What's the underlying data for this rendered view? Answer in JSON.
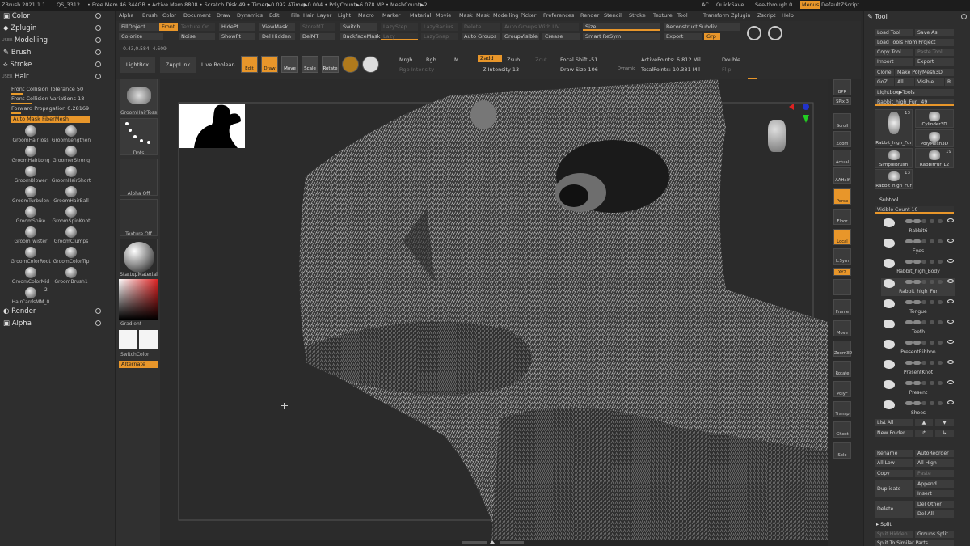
{
  "titlebar": {
    "app": "ZBrush 2021.1.1",
    "project": "QS_3312",
    "stats": "• Free Mem 46.344GB • Active Mem 8808 • Scratch Disk 49 • Timer▶0.092 ATime▶0.004 • PolyCount▶6.078 MP • MeshCount▶2",
    "ac": "AC",
    "quicksave": "QuickSave",
    "seethrough": "See-through  0",
    "menus": "Menus",
    "defaultzscript": "DefaultZScript"
  },
  "menubar": [
    "Alpha",
    "Brush",
    "Color",
    "Document",
    "Draw",
    "Dynamics",
    "Edit",
    "File",
    "Hair",
    "Layer",
    "Light",
    "Macro",
    "Marker",
    "Material",
    "Movie",
    "Mask",
    "Mask",
    "Modelling",
    "Picker",
    "Preferences",
    "Render",
    "Stencil",
    "Stroke",
    "Texture",
    "Tool",
    "Transform",
    "Zplugin",
    "Zscript",
    "Help"
  ],
  "left": {
    "sections": {
      "color": "Color",
      "zplugin": "Zplugin",
      "modelling": "Modelling",
      "brush": "Brush",
      "stroke": "Stroke",
      "hair": "Hair",
      "render": "Render",
      "alpha": "Alpha"
    },
    "user_tags": {
      "a": "USER",
      "b": "USER"
    },
    "sliders": [
      {
        "label": "Front Collision Tolerance",
        "value": "50",
        "fill": 0.5
      },
      {
        "label": "Front Collision Variations",
        "value": "18",
        "fill": 0.3
      },
      {
        "label": "Forward Propagation",
        "value": "0.28169",
        "fill": 0.28
      }
    ],
    "automask": "Auto Mask FiberMesh",
    "brushes": [
      "GroomHairToss",
      "GroomLengthen",
      "GroomHairLong",
      "GroomerStrong",
      "GroomBlower",
      "GroomHairShort",
      "GroomTurbulen",
      "GroomHairBall",
      "GroomSpike",
      "GroomSpinKnot",
      "GroomTwister",
      "GroomClumps",
      "GroomColorRoot",
      "GroomColorTip",
      "GroomColorMid",
      "GroomBrush1",
      "HairCardsMM_0",
      ""
    ],
    "hair_count": "2"
  },
  "midcol": {
    "thumbs": {
      "brush": "GroomHairToss",
      "stroke": "Dots",
      "alpha": "Alpha Off",
      "texture": "Texture Off",
      "material": "StartupMaterial"
    },
    "gradient": "Gradient",
    "switchcolor": "SwitchColor",
    "alternate": "Alternate"
  },
  "toolbar": {
    "fillobject": "FillObject",
    "front": "Front",
    "texture_on": "Texture On",
    "hidept": "HidePt",
    "viewmask": "ViewMask",
    "storemt": "StoreMT",
    "switch": "Switch",
    "lazystep": "LazyStep",
    "lazyradius": "LazyRadius",
    "delete": "Delete",
    "autogroups_uv": "Auto Groups With UV",
    "colorize": "Colorize",
    "noise": "Noise",
    "showpt": "ShowPt",
    "delhidden": "Del Hidden",
    "delmt": "DelMT",
    "backfacemask": "BackfaceMask",
    "lazymouse": "Lazy",
    "lazysnap": "LazySnap",
    "autogroups": "Auto Groups",
    "groupvisible": "GroupVisible",
    "crease": "Crease",
    "size": "Size",
    "smartresym": "Smart ReSym",
    "reconstruct": "Reconstruct Subdiv",
    "export": "Export",
    "grp": "Grp",
    "coords": "-0.43,0.584,-4.609",
    "lightbox": "LightBox",
    "zapplink": "ZAppLink",
    "live_boolean": "Live Boolean",
    "edit": "Edit",
    "draw": "Draw",
    "move": "Move",
    "scale": "Scale",
    "rotate": "Rotate",
    "mrgb": "Mrgb",
    "rgb": "Rgb",
    "m": "M",
    "rgb_intensity": "Rgb Intensity",
    "zadd": "Zadd",
    "zsub": "Zsub",
    "zcut": "Zcut",
    "z_intensity": "Z Intensity 13",
    "focal_shift": "Focal Shift -51",
    "draw_size": "Draw Size 106",
    "dynamic": "Dynamic",
    "active_points": "ActivePoints: 6.812 Mil",
    "total_points": "TotalPoints: 10.381 Mil",
    "double": "Double",
    "flip": "Flip"
  },
  "rightstrip": [
    "BPR",
    "SPix 3",
    "Scroll",
    "Zoom",
    "Actual",
    "AAHalf",
    "Persp",
    "Floor",
    "Local",
    "L.Sym",
    "XYZ",
    "",
    "Frame",
    "Move",
    "Zoom3D",
    "Rotate",
    "PolyF",
    "Transp",
    "Ghost",
    "Solo"
  ],
  "rightpal": {
    "title": "Tool",
    "buttons": {
      "load_tool": "Load Tool",
      "save_as": "Save As",
      "load_from_project": "Load Tools From Project",
      "copy_tool": "Copy Tool",
      "paste_tool": "Paste Tool",
      "import": "Import",
      "export": "Export",
      "clone": "Clone",
      "make_polymesh": "Make PolyMesh3D",
      "goz": "GoZ",
      "all": "All",
      "visible": "Visible",
      "r": "R",
      "lightbox_tools": "Lightbox▶Tools",
      "current_tool": "Rabbit_high_Fur_ 49"
    },
    "tools": [
      {
        "name": "Rabbit_high_Fur",
        "count": "13"
      },
      {
        "name": "Cylinder3D",
        "count": ""
      },
      {
        "name": "PolyMesh3D",
        "count": ""
      },
      {
        "name": "SimpleBrush",
        "count": ""
      },
      {
        "name": "RabbitFur_L2",
        "count": "19"
      },
      {
        "name": "Rabbit_high_Fur",
        "count": "13"
      }
    ],
    "subtool_header": "Subtool",
    "visible_count": "Visible Count 10",
    "subtools": [
      "Rabbit6",
      "Eyes",
      "Rabbit_high_Body",
      "Rabbit_high_Fur",
      "Tongue",
      "Teeth",
      "PresentRibbon",
      "PresentKnot",
      "Present",
      "Shoes"
    ],
    "bottom": {
      "list_all": "List All",
      "new_folder": "New Folder",
      "rename": "Rename",
      "autoreorder": "AutoReorder",
      "all_low": "All Low",
      "all_high": "All High",
      "copy": "Copy",
      "paste": "Paste",
      "duplicate": "Duplicate",
      "append": "Append",
      "insert": "Insert",
      "delete": "Delete",
      "del_other": "Del Other",
      "del_all": "Del All",
      "split": "Split",
      "split_hidden": "Split Hidden",
      "groups_split": "Groups Split",
      "split_similar": "Split To Similar Parts"
    }
  }
}
